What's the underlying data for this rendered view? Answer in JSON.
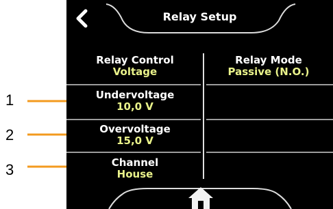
{
  "header": {
    "title": "Relay Setup",
    "back_icon": "chevron-left-icon"
  },
  "left_column": [
    {
      "label": "Relay Control",
      "value": "Voltage"
    },
    {
      "label": "Undervoltage",
      "value": "10,0 V"
    },
    {
      "label": "Overvoltage",
      "value": "15,0 V"
    },
    {
      "label": "Channel",
      "value": "House"
    }
  ],
  "right_column": [
    {
      "label": "Relay Mode",
      "value": "Passive (N.O.)"
    }
  ],
  "footer": {
    "home_icon": "home-icon"
  },
  "annotations": [
    {
      "number": "1"
    },
    {
      "number": "2"
    },
    {
      "number": "3"
    }
  ],
  "colors": {
    "label": "#ffffff",
    "value": "#e9f28a",
    "arrow": "#f39a1e",
    "background": "#000000"
  }
}
